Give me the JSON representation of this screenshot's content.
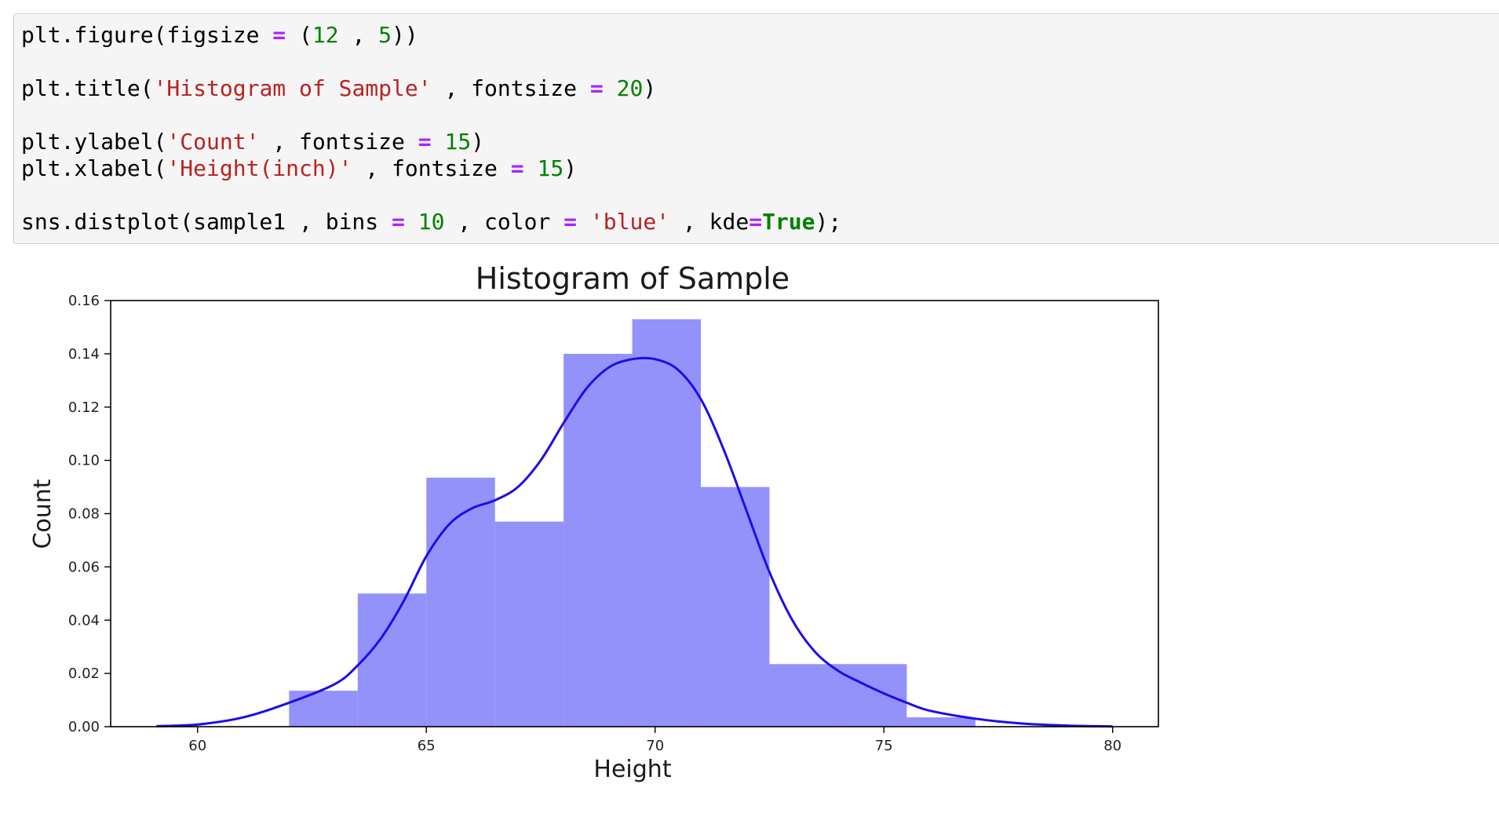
{
  "code_cell": {
    "lines": [
      [
        {
          "t": "plt.figure(figsize ",
          "k": "plain"
        },
        {
          "t": "=",
          "k": "op"
        },
        {
          "t": " (",
          "k": "plain"
        },
        {
          "t": "12",
          "k": "num"
        },
        {
          "t": " , ",
          "k": "plain"
        },
        {
          "t": "5",
          "k": "num"
        },
        {
          "t": "))",
          "k": "plain"
        }
      ],
      [],
      [
        {
          "t": "plt.title(",
          "k": "plain"
        },
        {
          "t": "'Histogram of Sample'",
          "k": "str"
        },
        {
          "t": " , fontsize ",
          "k": "plain"
        },
        {
          "t": "=",
          "k": "op"
        },
        {
          "t": " ",
          "k": "plain"
        },
        {
          "t": "20",
          "k": "num"
        },
        {
          "t": ")",
          "k": "plain"
        }
      ],
      [],
      [
        {
          "t": "plt.ylabel(",
          "k": "plain"
        },
        {
          "t": "'Count'",
          "k": "str"
        },
        {
          "t": " , fontsize ",
          "k": "plain"
        },
        {
          "t": "=",
          "k": "op"
        },
        {
          "t": " ",
          "k": "plain"
        },
        {
          "t": "15",
          "k": "num"
        },
        {
          "t": ")",
          "k": "plain"
        }
      ],
      [
        {
          "t": "plt.xlabel(",
          "k": "plain"
        },
        {
          "t": "'Height(inch)'",
          "k": "str"
        },
        {
          "t": " , fontsize ",
          "k": "plain"
        },
        {
          "t": "=",
          "k": "op"
        },
        {
          "t": " ",
          "k": "plain"
        },
        {
          "t": "15",
          "k": "num"
        },
        {
          "t": ")",
          "k": "plain"
        }
      ],
      [],
      [
        {
          "t": "sns.distplot(sample1 , bins ",
          "k": "plain"
        },
        {
          "t": "=",
          "k": "op"
        },
        {
          "t": " ",
          "k": "plain"
        },
        {
          "t": "10",
          "k": "num"
        },
        {
          "t": " , color ",
          "k": "plain"
        },
        {
          "t": "=",
          "k": "op"
        },
        {
          "t": " ",
          "k": "plain"
        },
        {
          "t": "'blue'",
          "k": "str"
        },
        {
          "t": " , kde",
          "k": "plain"
        },
        {
          "t": "=",
          "k": "op"
        },
        {
          "t": "True",
          "k": "kw"
        },
        {
          "t": ");",
          "k": "plain"
        }
      ]
    ]
  },
  "colors": {
    "bar_fill": "#9391fa",
    "kde_line": "#1c0de8",
    "axis": "#000000"
  },
  "chart_data": {
    "type": "bar",
    "subtype": "histogram_with_kde",
    "title": "Histogram of Sample",
    "xlabel": "Height",
    "ylabel": "Count",
    "xlim": [
      58.1,
      81.0
    ],
    "ylim": [
      0,
      0.16
    ],
    "xticks": [
      60,
      65,
      70,
      75,
      80
    ],
    "yticks": [
      0.0,
      0.02,
      0.04,
      0.06,
      0.08,
      0.1,
      0.12,
      0.14,
      0.16
    ],
    "ytick_labels": [
      "0.00",
      "0.02",
      "0.04",
      "0.06",
      "0.08",
      "0.10",
      "0.12",
      "0.14",
      "0.16"
    ],
    "grid": false,
    "bins": [
      {
        "x0": 62.0,
        "x1": 63.5,
        "density": 0.0135
      },
      {
        "x0": 63.5,
        "x1": 65.0,
        "density": 0.05
      },
      {
        "x0": 65.0,
        "x1": 66.5,
        "density": 0.0935
      },
      {
        "x0": 66.5,
        "x1": 68.0,
        "density": 0.077
      },
      {
        "x0": 68.0,
        "x1": 69.5,
        "density": 0.14
      },
      {
        "x0": 69.5,
        "x1": 71.0,
        "density": 0.153
      },
      {
        "x0": 71.0,
        "x1": 72.5,
        "density": 0.09
      },
      {
        "x0": 72.5,
        "x1": 74.0,
        "density": 0.0235
      },
      {
        "x0": 74.0,
        "x1": 75.5,
        "density": 0.0235
      },
      {
        "x0": 75.5,
        "x1": 77.0,
        "density": 0.0035
      }
    ],
    "kde": {
      "x": [
        59.1,
        60.0,
        61.0,
        62.0,
        63.0,
        63.5,
        64.0,
        64.5,
        65.0,
        65.5,
        66.0,
        66.5,
        67.0,
        67.5,
        68.0,
        68.5,
        69.0,
        69.5,
        70.0,
        70.5,
        71.0,
        71.5,
        72.0,
        72.5,
        73.0,
        73.5,
        74.0,
        74.5,
        75.0,
        75.5,
        76.0,
        77.0,
        78.0,
        79.0,
        80.0
      ],
      "y": [
        0.0002,
        0.0008,
        0.0035,
        0.009,
        0.016,
        0.023,
        0.033,
        0.047,
        0.064,
        0.076,
        0.082,
        0.085,
        0.09,
        0.1,
        0.114,
        0.127,
        0.135,
        0.138,
        0.138,
        0.134,
        0.123,
        0.104,
        0.081,
        0.058,
        0.04,
        0.028,
        0.021,
        0.0165,
        0.0125,
        0.009,
        0.006,
        0.003,
        0.0012,
        0.0004,
        0.0001
      ]
    }
  }
}
